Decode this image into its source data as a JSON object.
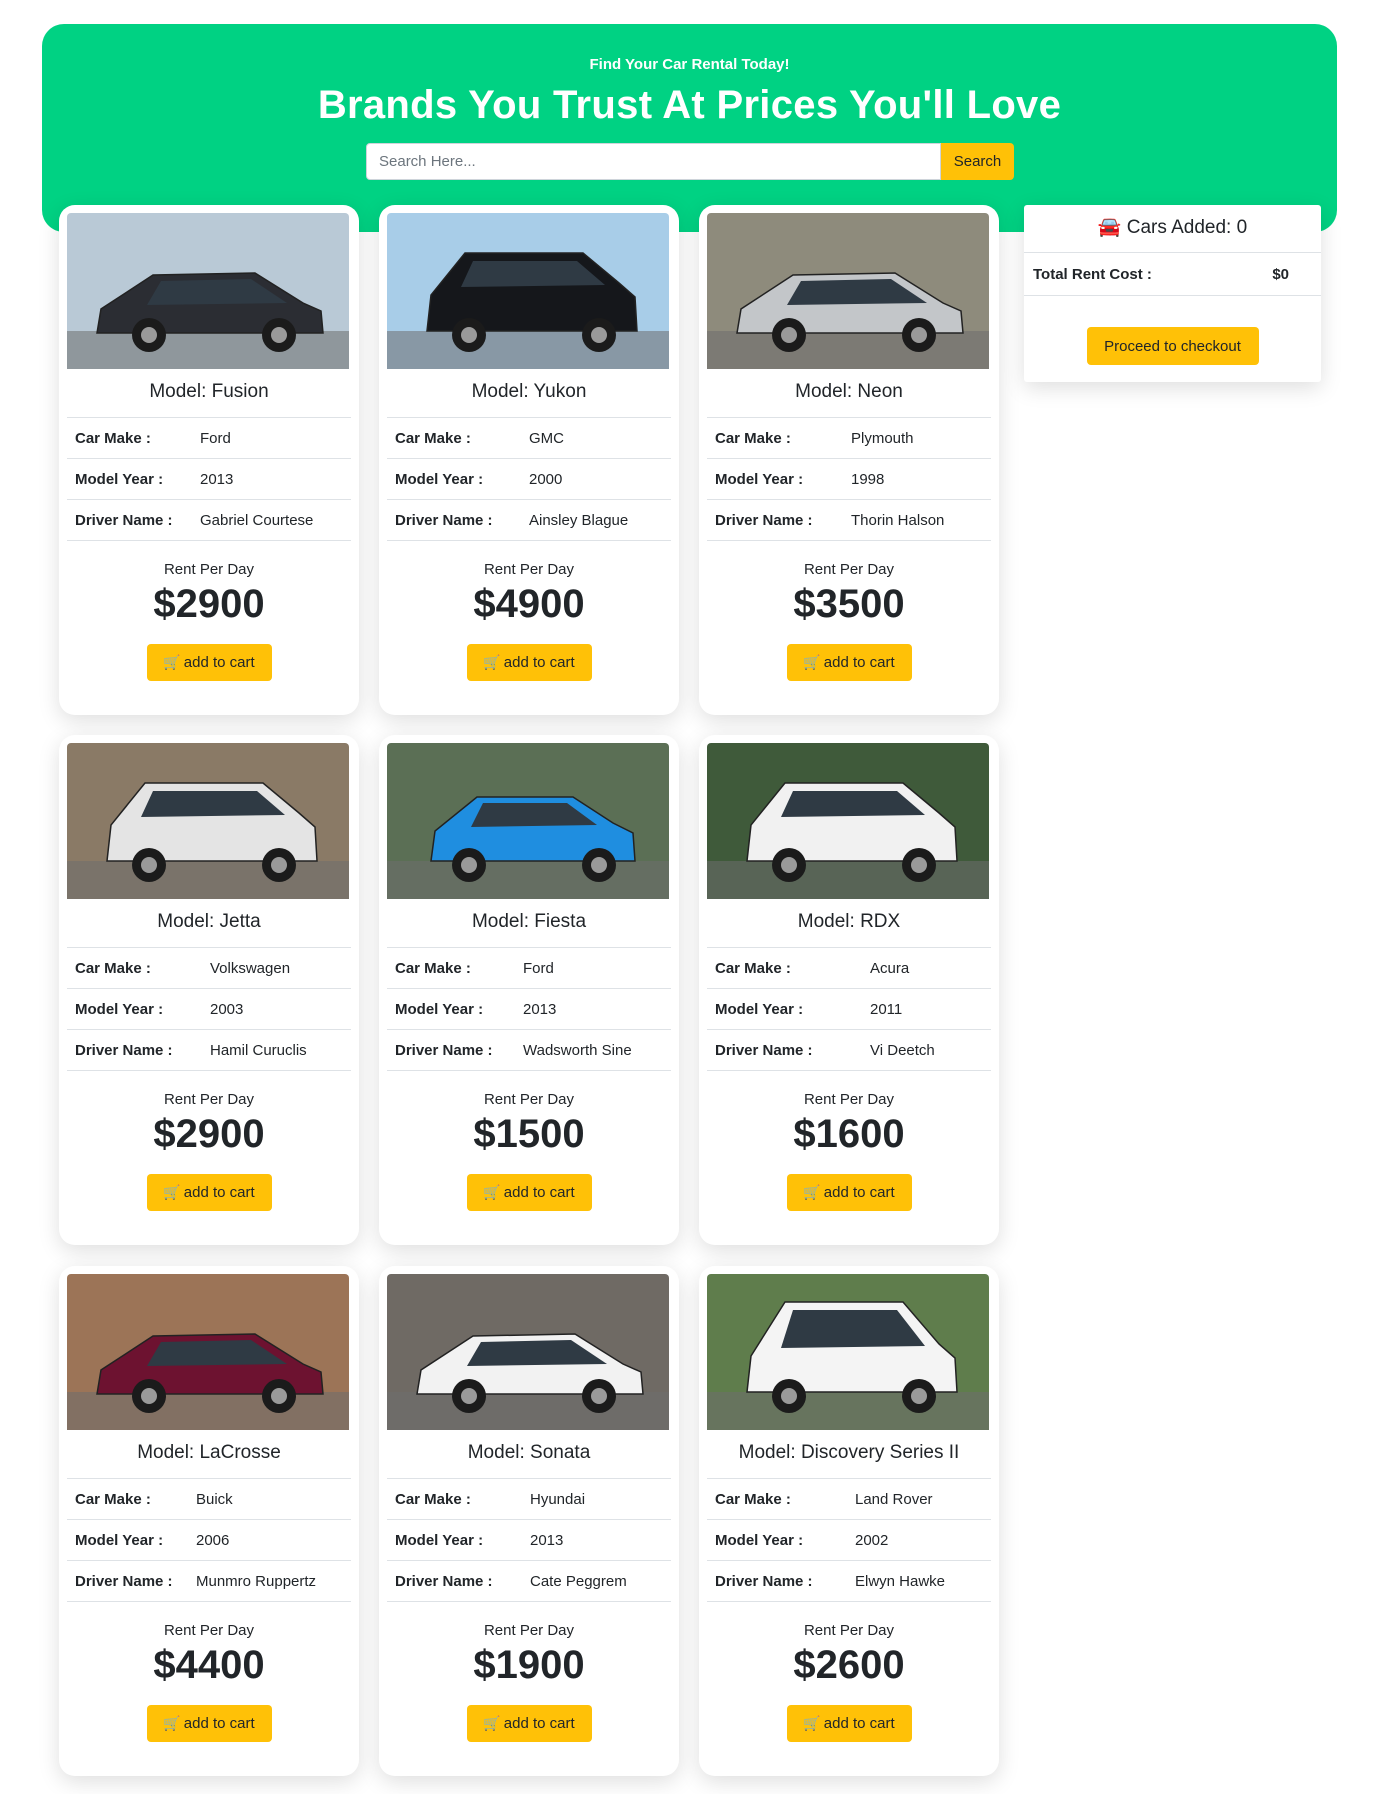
{
  "hero": {
    "tagline": "Find Your Car Rental Today!",
    "title": "Brands You Trust At Prices You'll Love",
    "bg_color": "#00d283"
  },
  "search": {
    "placeholder": "Search Here...",
    "button_label": "Search"
  },
  "labels": {
    "make": "Car Make :",
    "year": "Model Year :",
    "driver": "Driver Name :",
    "rent_per_day": "Rent Per Day",
    "add_to_cart": "add to cart"
  },
  "summary": {
    "cars_added_label": "Cars Added: 0",
    "total_label": "Total Rent Cost :",
    "total_value": "$0",
    "checkout_label": "Proceed to checkout"
  },
  "cars": [
    {
      "model": "Model: Fusion",
      "make": "Ford",
      "year": "2013",
      "driver": "Gabriel Courtese",
      "price": "$2900",
      "color": "#2b2d33",
      "body": "sedan",
      "bg": "#b9c9d6"
    },
    {
      "model": "Model: Yukon",
      "make": "GMC",
      "year": "2000",
      "driver": "Ainsley Blague",
      "price": "$4900",
      "color": "#15171b",
      "body": "suv",
      "bg": "#a8cde8"
    },
    {
      "model": "Model: Neon",
      "make": "Plymouth",
      "year": "1998",
      "driver": "Thorin Halson",
      "price": "$3500",
      "color": "#c3c6c9",
      "body": "sedan",
      "bg": "#8e8b7c"
    },
    {
      "model": "Model: Jetta",
      "make": "Volkswagen",
      "year": "2003",
      "driver": "Hamil Curuclis",
      "price": "$2900",
      "color": "#e4e4e4",
      "body": "suv",
      "bg": "#8a7a66"
    },
    {
      "model": "Model: Fiesta",
      "make": "Ford",
      "year": "2013",
      "driver": "Wadsworth Sine",
      "price": "$1500",
      "color": "#1f8ee0",
      "body": "hatch",
      "bg": "#5b6f55"
    },
    {
      "model": "Model: RDX",
      "make": "Acura",
      "year": "2011",
      "driver": "Vi Deetch",
      "price": "$1600",
      "color": "#f1f1f1",
      "body": "suv",
      "bg": "#3f5a3a"
    },
    {
      "model": "Model: LaCrosse",
      "make": "Buick",
      "year": "2006",
      "driver": "Munmro Ruppertz",
      "price": "$4400",
      "color": "#6d1230",
      "body": "sedan",
      "bg": "#9c7457"
    },
    {
      "model": "Model: Sonata",
      "make": "Hyundai",
      "year": "2013",
      "driver": "Cate Peggrem",
      "price": "$1900",
      "color": "#f2f2f2",
      "body": "sedan",
      "bg": "#6f6a64"
    },
    {
      "model": "Model: Discovery Series II",
      "make": "Land Rover",
      "year": "2002",
      "driver": "Elwyn Hawke",
      "price": "$2600",
      "color": "#f4f4f4",
      "body": "boxy",
      "bg": "#5f7d4c"
    }
  ]
}
